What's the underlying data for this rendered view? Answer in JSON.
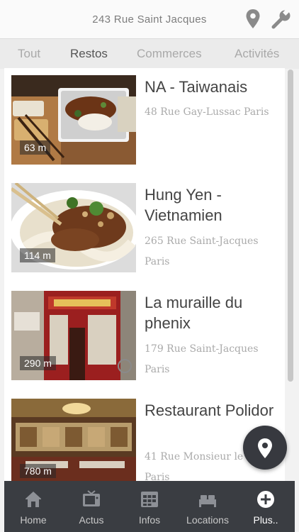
{
  "header": {
    "address": "243 Rue Saint Jacques",
    "location_icon": "map-pin-icon",
    "settings_icon": "wrench-icon"
  },
  "tabs": [
    {
      "label": "Tout",
      "active": false
    },
    {
      "label": "Restos",
      "active": true
    },
    {
      "label": "Commerces",
      "active": false
    },
    {
      "label": "Activités",
      "active": false
    }
  ],
  "restaurants": [
    {
      "name": "NA - Taiwanais",
      "address": "48 Rue Gay-Lussac Paris",
      "distance": "63 m"
    },
    {
      "name": "Hung Yen - Vietnamien",
      "address": "265 Rue Saint-Jacques Paris",
      "distance": "114 m"
    },
    {
      "name": "La muraille du phenix",
      "address": "179 Rue Saint-Jacques Paris",
      "distance": "290 m"
    },
    {
      "name": "Restaurant Polidor",
      "address": "41 Rue Monsieur le Prince Paris",
      "distance": "780 m"
    }
  ],
  "fab": {
    "icon": "map-pin-icon"
  },
  "bottom_nav": [
    {
      "label": "Home",
      "icon": "home-icon",
      "active": false
    },
    {
      "label": "Actus",
      "icon": "tv-icon",
      "active": false
    },
    {
      "label": "Infos",
      "icon": "calendar-grid-icon",
      "active": false
    },
    {
      "label": "Locations",
      "icon": "bed-icon",
      "active": false
    },
    {
      "label": "Plus..",
      "icon": "plus-circle-icon",
      "active": true
    }
  ]
}
